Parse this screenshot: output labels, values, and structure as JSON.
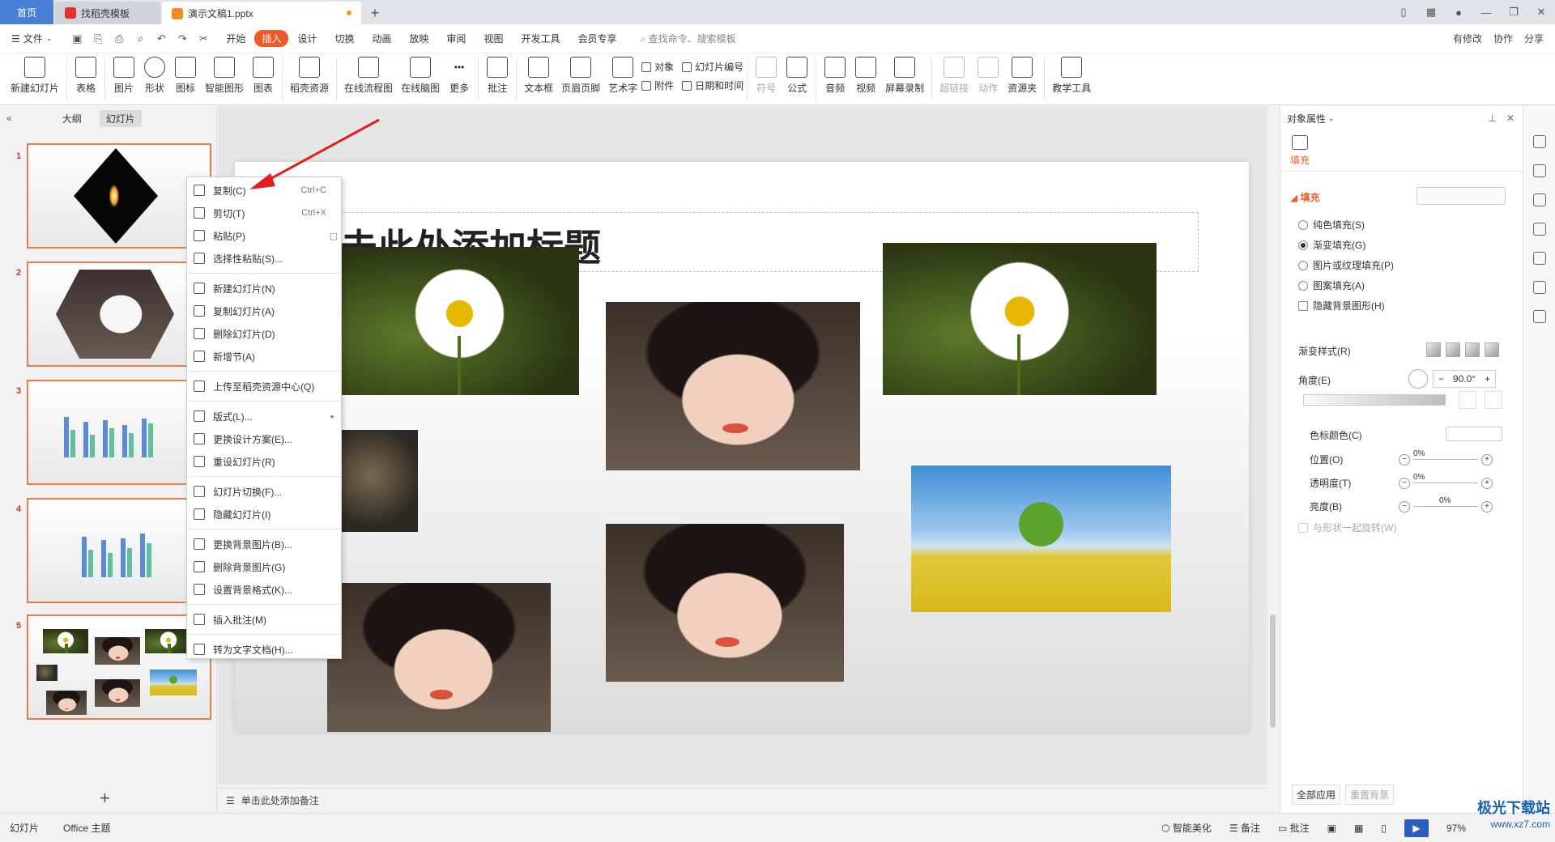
{
  "tabs": {
    "home": "首页",
    "template": "找稻壳模板",
    "doc": "演示文稿1.pptx"
  },
  "menu": {
    "file": "文件",
    "items": [
      "开始",
      "插入",
      "设计",
      "切换",
      "动画",
      "放映",
      "审阅",
      "视图",
      "开发工具",
      "会员专享"
    ],
    "active": "插入",
    "search": "查找命令、搜索模板",
    "right": [
      "有修改",
      "协作",
      "分享"
    ]
  },
  "ribbon": {
    "buttons": [
      "新建幻灯片",
      "表格",
      "图片",
      "形状",
      "图标",
      "智能图形",
      "图表",
      "稻壳资源",
      "在线流程图",
      "在线脑图",
      "更多",
      "批注",
      "文本框",
      "页眉页脚",
      "艺术字"
    ],
    "small": [
      "对象",
      "幻灯片编号",
      "附件",
      "日期和时间"
    ],
    "buttons2": [
      "符号",
      "公式",
      "音频",
      "视频",
      "屏幕录制",
      "超链接",
      "动作",
      "资源夹",
      "教学工具"
    ]
  },
  "leftpanel": {
    "tab_outline": "大纲",
    "tab_slides": "幻灯片",
    "slide_numbers": [
      "1",
      "2",
      "3",
      "4",
      "5"
    ],
    "add": "+"
  },
  "slide": {
    "title": "击此处添加标题"
  },
  "notes": "单击此处添加备注",
  "context_menu": {
    "items": [
      {
        "label": "复制(C)",
        "shortcut": "Ctrl+C"
      },
      {
        "label": "剪切(T)",
        "shortcut": "Ctrl+X"
      },
      {
        "label": "粘贴(P)",
        "shortcut": ""
      },
      {
        "label": "选择性粘贴(S)...",
        "shortcut": ""
      },
      {
        "label": "新建幻灯片(N)",
        "shortcut": ""
      },
      {
        "label": "复制幻灯片(A)",
        "shortcut": ""
      },
      {
        "label": "删除幻灯片(D)",
        "shortcut": ""
      },
      {
        "label": "新增节(A)",
        "shortcut": ""
      },
      {
        "label": "上传至稻壳资源中心(Q)",
        "shortcut": ""
      },
      {
        "label": "版式(L)...",
        "shortcut": ""
      },
      {
        "label": "更换设计方案(E)...",
        "shortcut": ""
      },
      {
        "label": "重设幻灯片(R)",
        "shortcut": ""
      },
      {
        "label": "幻灯片切换(F)...",
        "shortcut": ""
      },
      {
        "label": "隐藏幻灯片(I)",
        "shortcut": ""
      },
      {
        "label": "更换背景图片(B)...",
        "shortcut": ""
      },
      {
        "label": "删除背景图片(G)",
        "shortcut": ""
      },
      {
        "label": "设置背景格式(K)...",
        "shortcut": ""
      },
      {
        "label": "插入批注(M)",
        "shortcut": ""
      },
      {
        "label": "转为文字文档(H)...",
        "shortcut": ""
      }
    ]
  },
  "rightpanel": {
    "title": "对象属性",
    "tab": "填充",
    "section": "填充",
    "options": [
      "纯色填充(S)",
      "渐变填充(G)",
      "图片或纹理填充(P)",
      "图案填充(A)",
      "隐藏背景图形(H)"
    ],
    "gradient_style": "渐变样式(R)",
    "angle_label": "角度(E)",
    "angle_value": "90.0°",
    "color_label": "色标颜色(C)",
    "position_label": "位置(O)",
    "transparency_label": "透明度(T)",
    "brightness_label": "亮度(B)",
    "pct": [
      "0%",
      "0%",
      "0%"
    ],
    "rotate_label": "与形状一起旋转(W)",
    "apply_all": "全部应用",
    "reset_bg": "重置背景"
  },
  "status": {
    "slide": "幻灯片",
    "theme": "Office 主题",
    "beautify": "智能美化",
    "notes": "备注",
    "comments": "批注",
    "zoom": "97%"
  },
  "watermark": {
    "name": "极光下载站",
    "url": "www.xz7.com"
  },
  "colors": {
    "accent": "#f05a28",
    "tab_active": "#4a7fd6",
    "arrow": "#e02020"
  }
}
